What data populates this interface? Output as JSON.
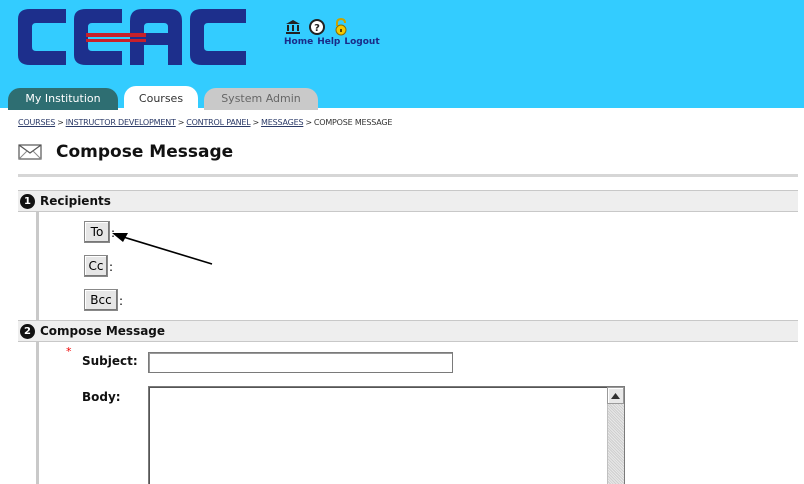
{
  "header": {
    "logo_text": "CCAC",
    "nav_links": [
      "Home",
      "Help",
      "Logout"
    ],
    "nav_icons": [
      "institution-icon",
      "help-icon",
      "lock-icon"
    ],
    "colors": {
      "banner": "#33ccff",
      "logo_blue": "#1d2f8c",
      "logo_red": "#c8202a"
    }
  },
  "tabs": [
    {
      "label": "My Institution",
      "state": "inactive"
    },
    {
      "label": "Courses",
      "state": "active"
    },
    {
      "label": "System Admin",
      "state": "disabled"
    }
  ],
  "breadcrumb": {
    "items": [
      "COURSES",
      "INSTRUCTOR DEVELOPMENT",
      "CONTROL PANEL",
      "MESSAGES",
      "COMPOSE MESSAGE"
    ],
    "separator": ">"
  },
  "page": {
    "title": "Compose Message",
    "icon": "envelope-icon"
  },
  "sections": {
    "recipients": {
      "number": "1",
      "title": "Recipients",
      "buttons": [
        {
          "label": "To",
          "suffix": ":"
        },
        {
          "label": "Cc",
          "suffix": ":"
        },
        {
          "label": "Bcc",
          "suffix": ":"
        }
      ]
    },
    "compose": {
      "number": "2",
      "title": "Compose Message",
      "required_marker": "*",
      "subject_label": "Subject:",
      "subject_value": "",
      "body_label": "Body:",
      "body_value": ""
    }
  }
}
